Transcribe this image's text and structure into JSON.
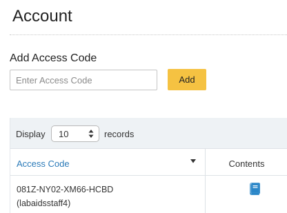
{
  "page": {
    "title": "Account"
  },
  "add_access_code": {
    "label": "Add Access Code",
    "input_value": "",
    "input_placeholder": "Enter Access Code",
    "button_label": "Add",
    "button_color": "#f5c242"
  },
  "table": {
    "length_menu": {
      "prefix": "Display",
      "selected": "10",
      "suffix": "records"
    },
    "columns": [
      {
        "label": "Access Code",
        "sort_icon": "sort-desc-icon",
        "color": "#2a7ab8"
      },
      {
        "label": "Contents"
      }
    ],
    "rows": [
      {
        "code": "081Z-NY02-XM66-HCBD",
        "owner": "(labaidsstaff4)",
        "contents_icon": "book-icon",
        "icon_color": "#2a86c8"
      }
    ]
  }
}
